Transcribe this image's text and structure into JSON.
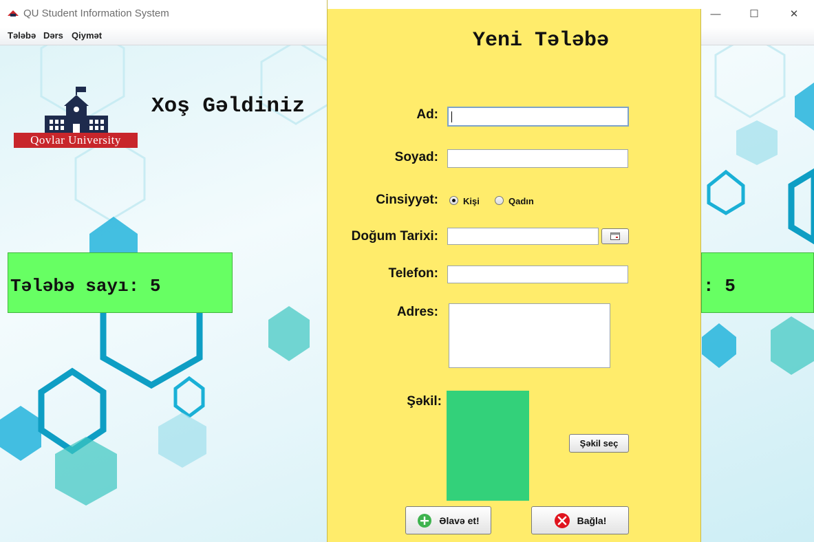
{
  "window": {
    "title": "QU Student Information System"
  },
  "menu": {
    "items": [
      "Tələbə",
      "Dərs",
      "Qiymət"
    ]
  },
  "main": {
    "welcome": "Xoş Gəldiniz",
    "university_banner": "Qovlar University",
    "student_count_left": "Tələbə sayı: 5",
    "student_count_right": ": 5"
  },
  "dialog": {
    "title": "Yeni Tələbə",
    "labels": {
      "name": "Ad:",
      "surname": "Soyad:",
      "gender": "Cinsiyyət:",
      "birth_date": "Doğum Tarixi:",
      "phone": "Telefon:",
      "address": "Adres:",
      "photo": "Şəkil:"
    },
    "fields": {
      "name": "",
      "surname": "",
      "birth_date": "",
      "phone": "",
      "address": ""
    },
    "gender_options": [
      {
        "label": "Kişi",
        "selected": true
      },
      {
        "label": "Qadın",
        "selected": false
      }
    ],
    "buttons": {
      "choose_photo": "Şəkil seç",
      "add": "Əlavə et!",
      "close": "Bağla!"
    }
  },
  "colors": {
    "dialog_bg": "#ffec6b",
    "count_box": "#67ff63",
    "photo": "#33d17a",
    "banner": "#c8262b"
  },
  "icons": [
    "app-logo-icon",
    "minimize-icon",
    "maximize-icon",
    "close-icon",
    "calendar-icon",
    "add-icon",
    "cancel-icon"
  ]
}
